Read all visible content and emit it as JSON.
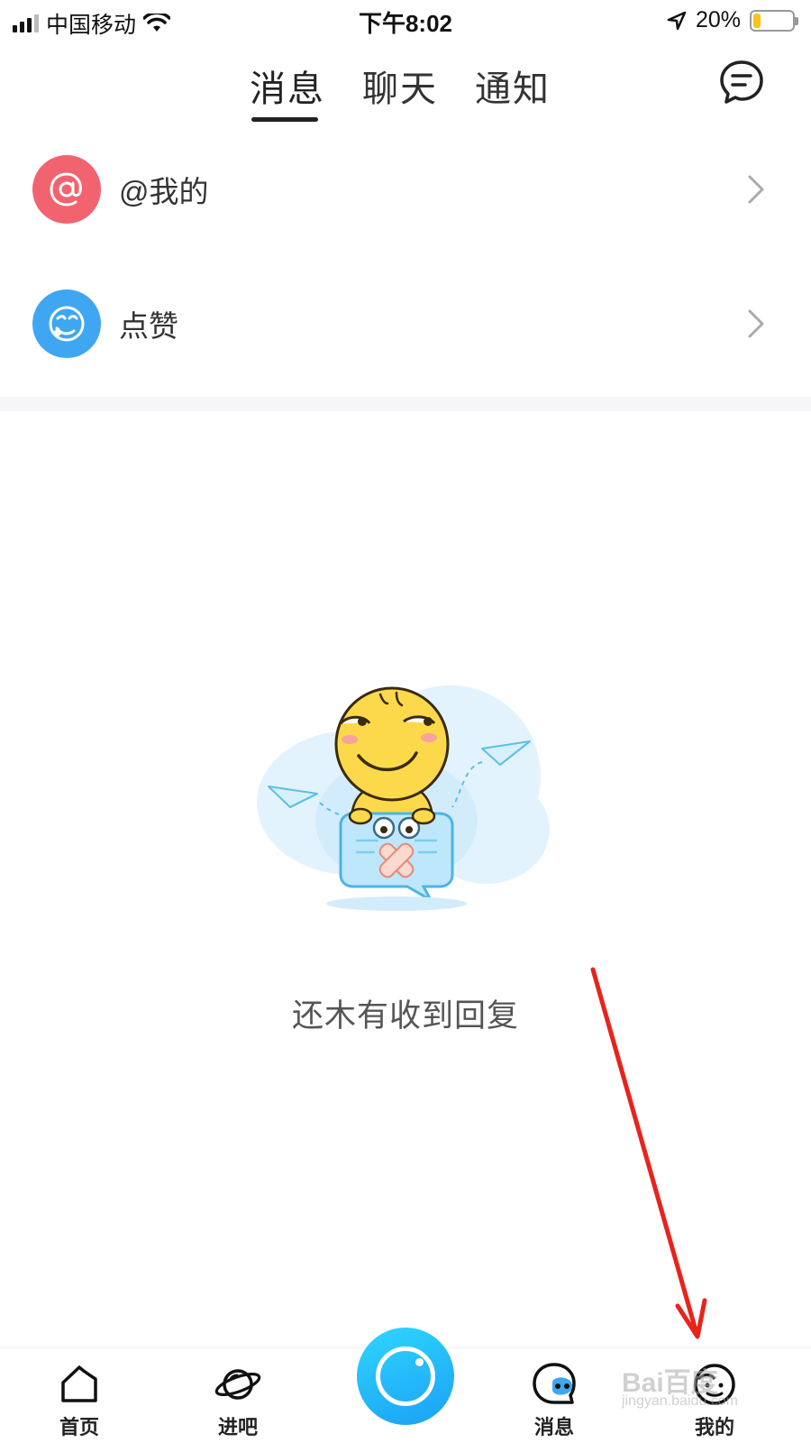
{
  "status_bar": {
    "carrier": "中国移动",
    "time": "下午8:02",
    "battery_percent": "20%",
    "battery_level": 0.2
  },
  "top_tabs": {
    "items": [
      "消息",
      "聊天",
      "通知"
    ],
    "active": "消息"
  },
  "list": [
    {
      "label": "@我的",
      "icon": "at-icon",
      "color": "#f26370"
    },
    {
      "label": "点赞",
      "icon": "like-face-icon",
      "color": "#3fa6f2"
    }
  ],
  "empty_state": {
    "text": "还木有收到回复"
  },
  "bottom_nav": {
    "items": [
      {
        "label": "首页",
        "icon": "home-icon"
      },
      {
        "label": "进吧",
        "icon": "planet-icon"
      },
      {
        "label": "消息",
        "icon": "message-face-icon"
      },
      {
        "label": "我的",
        "icon": "profile-face-icon"
      }
    ],
    "center_icon": "camera-icon"
  },
  "watermark": {
    "text": "Bai百度",
    "sub": "jingyan.baidu.com"
  },
  "colors": {
    "accent_blue": "#1ba0f5",
    "at_red": "#f26370",
    "like_blue": "#3fa6f2",
    "annotation_red": "#e8231c"
  }
}
